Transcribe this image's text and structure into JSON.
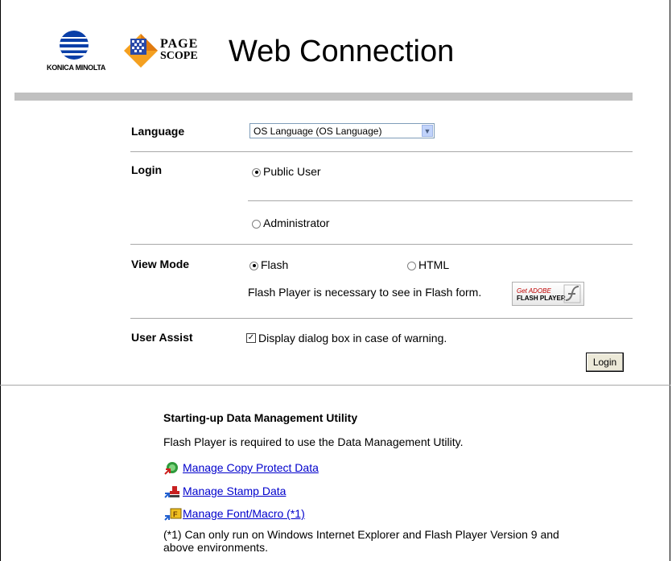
{
  "header": {
    "brand_name": "KONICA MINOLTA",
    "product_small_top": "PAGE",
    "product_small_bottom": "SCOPE",
    "product_name": "Web Connection"
  },
  "form": {
    "language": {
      "label": "Language",
      "selected": "OS Language (OS Language)"
    },
    "login": {
      "label": "Login",
      "options": [
        "Public User",
        "Administrator"
      ],
      "selected_index": 0
    },
    "view_mode": {
      "label": "View Mode",
      "options": [
        "Flash",
        "HTML"
      ],
      "selected_index": 0,
      "note": "Flash Player is necessary to see in Flash form.",
      "badge_line1": "Get ADOBE",
      "badge_line2": "FLASH PLAYER"
    },
    "user_assist": {
      "label": "User Assist",
      "checkbox_label": "Display dialog box in case of warning.",
      "checked": true
    },
    "login_button": "Login"
  },
  "utility": {
    "title": "Starting-up Data Management Utility",
    "description": "Flash Player is required to use the Data Management Utility.",
    "links": [
      "Manage Copy Protect Data",
      "Manage Stamp Data",
      "Manage Font/Macro (*1)"
    ],
    "footnote_line1": "(*1) Can only run on Windows Internet Explorer and Flash Player Version 9 and",
    "footnote_line2": "above environments."
  },
  "colors": {
    "header_bar": "#c0c0c0",
    "link": "#0000cc",
    "divider": "#a8a8a8",
    "logo_blue": "#0a3fa8"
  }
}
